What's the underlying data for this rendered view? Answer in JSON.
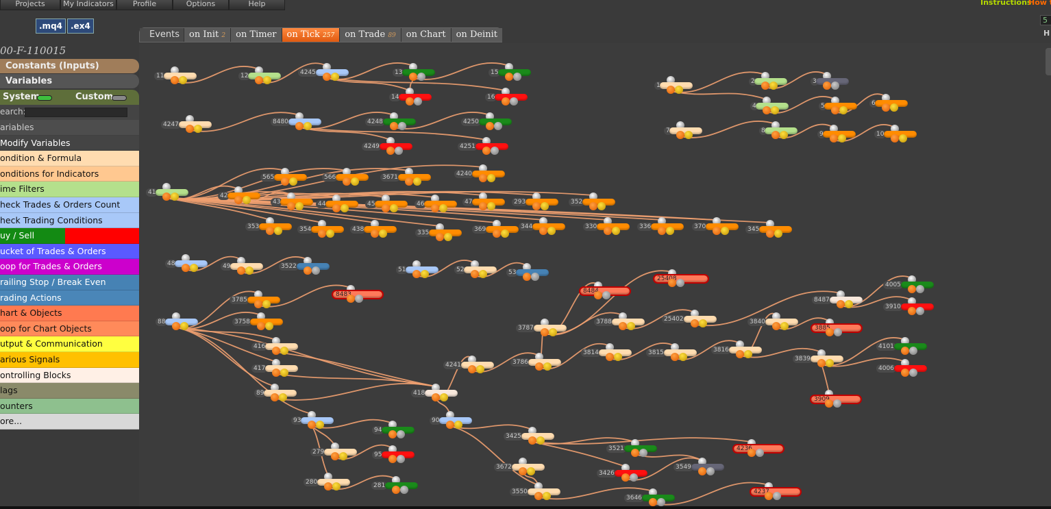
{
  "menu": [
    "Projects",
    "My Indicators",
    "Profile",
    "Options",
    "Help"
  ],
  "top_right": {
    "instructions": "Instructions",
    "howto": "How t",
    "label_a": "5",
    "label_b": "H"
  },
  "file_buttons": [
    ".mq4",
    ".ex4"
  ],
  "tabs": [
    {
      "label": "Events",
      "count": ""
    },
    {
      "label": "on Init",
      "count": "2"
    },
    {
      "label": "on Timer",
      "count": ""
    },
    {
      "label": "on Tick",
      "count": "257"
    },
    {
      "label": "on Trade",
      "count": "89"
    },
    {
      "label": "on Chart",
      "count": ""
    },
    {
      "label": "on Deinit",
      "count": ""
    }
  ],
  "project_title": "00-F-110015",
  "sidebar": {
    "constants": "Constants (Inputs)",
    "variables": "Variables",
    "system": "System",
    "custom": "Custom",
    "search_label": "earch:",
    "search_value": "",
    "categories": [
      "ariables",
      "Modify Variables",
      "ondition & Formula",
      "onditions for Indicators",
      "ime Filters",
      "heck Trades & Orders Count",
      "heck Trading Conditions",
      "uy / Sell",
      "ucket of Trades & Orders",
      "oop for Trades & Orders",
      "railing Stop / Break Even",
      "rading Actions",
      "hart & Objects",
      "oop for Chart Objects",
      "utput & Communication",
      "arious Signals",
      "ontrolling Blocks",
      "lags",
      "ounters",
      "ore..."
    ]
  },
  "colors": {
    "cond": "#ffdcb0",
    "var": "#a8c8f8",
    "time": "#b4e08c",
    "green": "#1a8a1a",
    "red": "#ff1010",
    "orange": "#ff8c00",
    "chart": "#ff7a5a",
    "steel": "#4682b4",
    "gray": "#666677",
    "white": "#f8e8dc"
  },
  "nodes": [
    {
      "id": "11",
      "t": "cond"
    },
    {
      "id": "12",
      "t": "time"
    },
    {
      "id": "4245",
      "t": "var"
    },
    {
      "id": "13",
      "t": "green"
    },
    {
      "id": "15",
      "t": "green"
    },
    {
      "id": "14",
      "t": "red"
    },
    {
      "id": "16",
      "t": "red"
    },
    {
      "id": "4247",
      "t": "cond"
    },
    {
      "id": "8480",
      "t": "var"
    },
    {
      "id": "4248",
      "t": "green"
    },
    {
      "id": "4250",
      "t": "green"
    },
    {
      "id": "4249",
      "t": "red"
    },
    {
      "id": "4251",
      "t": "red"
    },
    {
      "id": "1",
      "t": "cond"
    },
    {
      "id": "2",
      "t": "time"
    },
    {
      "id": "3",
      "t": "gray"
    },
    {
      "id": "4",
      "t": "time"
    },
    {
      "id": "5",
      "t": "orange"
    },
    {
      "id": "6",
      "t": "orange"
    },
    {
      "id": "7",
      "t": "cond"
    },
    {
      "id": "8",
      "t": "time"
    },
    {
      "id": "9",
      "t": "orange"
    },
    {
      "id": "10",
      "t": "orange"
    },
    {
      "id": "41",
      "t": "time"
    },
    {
      "id": "565",
      "t": "orange"
    },
    {
      "id": "566",
      "t": "orange"
    },
    {
      "id": "3671",
      "t": "orange"
    },
    {
      "id": "4240",
      "t": "orange"
    },
    {
      "id": "42",
      "t": "orange"
    },
    {
      "id": "43",
      "t": "orange"
    },
    {
      "id": "44",
      "t": "orange"
    },
    {
      "id": "45",
      "t": "orange"
    },
    {
      "id": "46",
      "t": "orange"
    },
    {
      "id": "47",
      "t": "orange"
    },
    {
      "id": "293",
      "t": "orange"
    },
    {
      "id": "352",
      "t": "orange"
    },
    {
      "id": "353",
      "t": "orange"
    },
    {
      "id": "354",
      "t": "orange"
    },
    {
      "id": "438",
      "t": "orange"
    },
    {
      "id": "335",
      "t": "orange"
    },
    {
      "id": "369",
      "t": "orange"
    },
    {
      "id": "344",
      "t": "orange"
    },
    {
      "id": "330",
      "t": "orange"
    },
    {
      "id": "336",
      "t": "orange"
    },
    {
      "id": "370",
      "t": "orange"
    },
    {
      "id": "345",
      "t": "orange"
    },
    {
      "id": "48",
      "t": "var"
    },
    {
      "id": "49",
      "t": "cond"
    },
    {
      "id": "3522",
      "t": "steel"
    },
    {
      "id": "51",
      "t": "var"
    },
    {
      "id": "52",
      "t": "cond"
    },
    {
      "id": "53",
      "t": "steel"
    },
    {
      "id": "88",
      "t": "var"
    },
    {
      "id": "3785",
      "t": "orange"
    },
    {
      "id": "8483",
      "t": "chart"
    },
    {
      "id": "3758",
      "t": "orange"
    },
    {
      "id": "416",
      "t": "cond"
    },
    {
      "id": "417",
      "t": "cond"
    },
    {
      "id": "89",
      "t": "cond"
    },
    {
      "id": "418",
      "t": "white"
    },
    {
      "id": "93",
      "t": "var"
    },
    {
      "id": "94",
      "t": "green"
    },
    {
      "id": "279",
      "t": "cond"
    },
    {
      "id": "95",
      "t": "red"
    },
    {
      "id": "280",
      "t": "cond"
    },
    {
      "id": "281",
      "t": "green"
    },
    {
      "id": "90",
      "t": "var"
    },
    {
      "id": "4241",
      "t": "cond"
    },
    {
      "id": "3786",
      "t": "cond"
    },
    {
      "id": "3787",
      "t": "cond"
    },
    {
      "id": "8484",
      "t": "chart"
    },
    {
      "id": "25408",
      "t": "chart"
    },
    {
      "id": "3788",
      "t": "cond"
    },
    {
      "id": "25402",
      "t": "cond"
    },
    {
      "id": "3840",
      "t": "cond"
    },
    {
      "id": "8487",
      "t": "white"
    },
    {
      "id": "4005",
      "t": "green"
    },
    {
      "id": "3910",
      "t": "red"
    },
    {
      "id": "3885",
      "t": "chart"
    },
    {
      "id": "3814",
      "t": "cond"
    },
    {
      "id": "3815",
      "t": "cond"
    },
    {
      "id": "3816",
      "t": "cond"
    },
    {
      "id": "3839",
      "t": "cond"
    },
    {
      "id": "4101",
      "t": "green"
    },
    {
      "id": "4006",
      "t": "red"
    },
    {
      "id": "3909",
      "t": "chart"
    },
    {
      "id": "3425",
      "t": "cond"
    },
    {
      "id": "3521",
      "t": "green"
    },
    {
      "id": "4236",
      "t": "chart"
    },
    {
      "id": "3672",
      "t": "cond"
    },
    {
      "id": "3549",
      "t": "gray"
    },
    {
      "id": "3426",
      "t": "red"
    },
    {
      "id": "3550",
      "t": "cond"
    },
    {
      "id": "3646",
      "t": "green"
    },
    {
      "id": "4237",
      "t": "chart"
    }
  ],
  "links": [
    [
      "11",
      "12"
    ],
    [
      "12",
      "4245"
    ],
    [
      "4245",
      "13"
    ],
    [
      "13",
      "15"
    ],
    [
      "4245",
      "14"
    ],
    [
      "4245",
      "16"
    ],
    [
      "13",
      "14"
    ],
    [
      "4247",
      "8480"
    ],
    [
      "8480",
      "4248"
    ],
    [
      "4248",
      "4250"
    ],
    [
      "8480",
      "4249"
    ],
    [
      "8480",
      "4251"
    ],
    [
      "1",
      "2"
    ],
    [
      "2",
      "3"
    ],
    [
      "1",
      "4"
    ],
    [
      "4",
      "5"
    ],
    [
      "5",
      "6"
    ],
    [
      "7",
      "8"
    ],
    [
      "8",
      "9"
    ],
    [
      "9",
      "10"
    ],
    [
      "41",
      "565"
    ],
    [
      "41",
      "566"
    ],
    [
      "41",
      "3671"
    ],
    [
      "41",
      "4240"
    ],
    [
      "41",
      "42"
    ],
    [
      "41",
      "43"
    ],
    [
      "41",
      "44"
    ],
    [
      "41",
      "45"
    ],
    [
      "41",
      "46"
    ],
    [
      "41",
      "47"
    ],
    [
      "41",
      "293"
    ],
    [
      "41",
      "352"
    ],
    [
      "41",
      "353"
    ],
    [
      "41",
      "354"
    ],
    [
      "41",
      "438"
    ],
    [
      "41",
      "335"
    ],
    [
      "41",
      "369"
    ],
    [
      "41",
      "344"
    ],
    [
      "41",
      "330"
    ],
    [
      "41",
      "336"
    ],
    [
      "41",
      "370"
    ],
    [
      "41",
      "345"
    ],
    [
      "42",
      "43"
    ],
    [
      "48",
      "49"
    ],
    [
      "49",
      "3522"
    ],
    [
      "51",
      "52"
    ],
    [
      "52",
      "53"
    ],
    [
      "88",
      "3785"
    ],
    [
      "3785",
      "8483"
    ],
    [
      "88",
      "3758"
    ],
    [
      "88",
      "416"
    ],
    [
      "88",
      "417"
    ],
    [
      "88",
      "89"
    ],
    [
      "416",
      "418"
    ],
    [
      "417",
      "418"
    ],
    [
      "89",
      "418"
    ],
    [
      "88",
      "418"
    ],
    [
      "418",
      "90"
    ],
    [
      "418",
      "4241"
    ],
    [
      "88",
      "93"
    ],
    [
      "93",
      "94"
    ],
    [
      "93",
      "279"
    ],
    [
      "279",
      "95"
    ],
    [
      "93",
      "280"
    ],
    [
      "280",
      "281"
    ],
    [
      "90",
      "3425"
    ],
    [
      "90",
      "3550"
    ],
    [
      "4241",
      "3786"
    ],
    [
      "3786",
      "3787"
    ],
    [
      "3787",
      "8484"
    ],
    [
      "3787",
      "25408"
    ],
    [
      "3787",
      "3788"
    ],
    [
      "3788",
      "25402"
    ],
    [
      "25402",
      "8487"
    ],
    [
      "8487",
      "4005"
    ],
    [
      "8487",
      "3910"
    ],
    [
      "3840",
      "3885"
    ],
    [
      "3816",
      "3840"
    ],
    [
      "3786",
      "3814"
    ],
    [
      "3814",
      "3815"
    ],
    [
      "3815",
      "3816"
    ],
    [
      "3816",
      "3839"
    ],
    [
      "3839",
      "4101"
    ],
    [
      "3839",
      "4006"
    ],
    [
      "3839",
      "3909"
    ],
    [
      "3425",
      "3521"
    ],
    [
      "3521",
      "3549"
    ],
    [
      "3425",
      "4236"
    ],
    [
      "3425",
      "3426"
    ],
    [
      "3426",
      "3549"
    ],
    [
      "3672",
      "3550"
    ],
    [
      "3550",
      "3646"
    ],
    [
      "3646",
      "4237"
    ]
  ]
}
